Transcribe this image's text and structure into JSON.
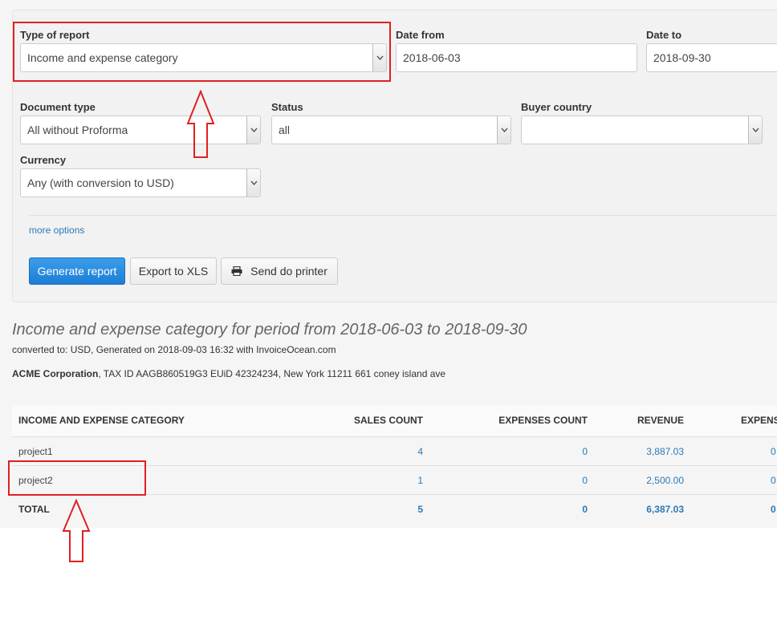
{
  "filters": {
    "type_of_report": {
      "label": "Type of report",
      "value": "Income and expense category"
    },
    "date_from": {
      "label": "Date from",
      "value": "2018-06-03"
    },
    "date_to": {
      "label": "Date to",
      "value": "2018-09-30"
    },
    "document_type": {
      "label": "Document type",
      "value": "All without Proforma"
    },
    "status": {
      "label": "Status",
      "value": "all"
    },
    "buyer_country": {
      "label": "Buyer country",
      "value": ""
    },
    "currency": {
      "label": "Currency",
      "value": "Any (with conversion to USD)"
    }
  },
  "more_options": "more options",
  "buttons": {
    "generate": "Generate report",
    "export": "Export to XLS",
    "print": "Send do printer"
  },
  "report": {
    "title": "Income and expense category for period from 2018-06-03 to 2018-09-30",
    "subtitle": "converted to: USD, Generated on 2018-09-03 16:32 with InvoiceOcean.com",
    "company_name": "ACME Corporation",
    "company_details": ", TAX ID AAGB860519G3 EUiD 42324234, New York 11211 661 coney island ave"
  },
  "table": {
    "headers": [
      "INCOME AND EXPENSE CATEGORY",
      "SALES COUNT",
      "EXPENSES COUNT",
      "REVENUE",
      "EXPENS"
    ],
    "rows": [
      {
        "category": "project1",
        "sales_count": "4",
        "expenses_count": "0",
        "revenue": "3,887.03",
        "expenses": "0"
      },
      {
        "category": "project2",
        "sales_count": "1",
        "expenses_count": "0",
        "revenue": "2,500.00",
        "expenses": "0"
      }
    ],
    "total": {
      "category": "TOTAL",
      "sales_count": "5",
      "expenses_count": "0",
      "revenue": "6,387.03",
      "expenses": "0"
    }
  },
  "colors": {
    "annotation": "#e02020",
    "link": "#2a7ab7",
    "primary": "#1c7ed6"
  },
  "icons": [
    "chevron-down-icon",
    "printer-icon",
    "up-arrow-annotation"
  ]
}
